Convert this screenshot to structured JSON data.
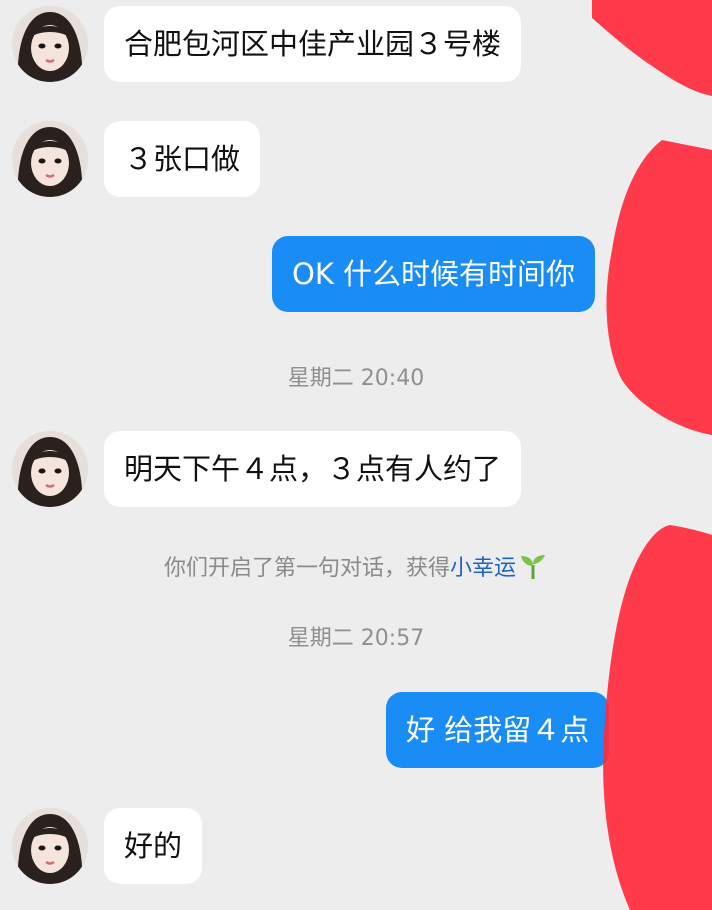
{
  "colors": {
    "background": "#ededed",
    "incoming_bubble": "#ffffff",
    "outgoing_bubble": "#1a8cf5",
    "timestamp_text": "#8f8f8f",
    "link": "#1e63c9",
    "redaction": "#ff2a3d"
  },
  "messages": {
    "m1": "合肥包河区中佳产业园３号楼",
    "m2": "３张口做",
    "m3": "OK 什么时候有时间你",
    "m4": "明天下午４点，３点有人约了",
    "m5": "好 给我留４点",
    "m6": "好的"
  },
  "timestamps": {
    "t1": "星期二 20:40",
    "t2": "星期二 20:57"
  },
  "system": {
    "prefix": "你们开启了第一句对话，获得",
    "link": "小幸运",
    "icon": "sprout-icon"
  }
}
